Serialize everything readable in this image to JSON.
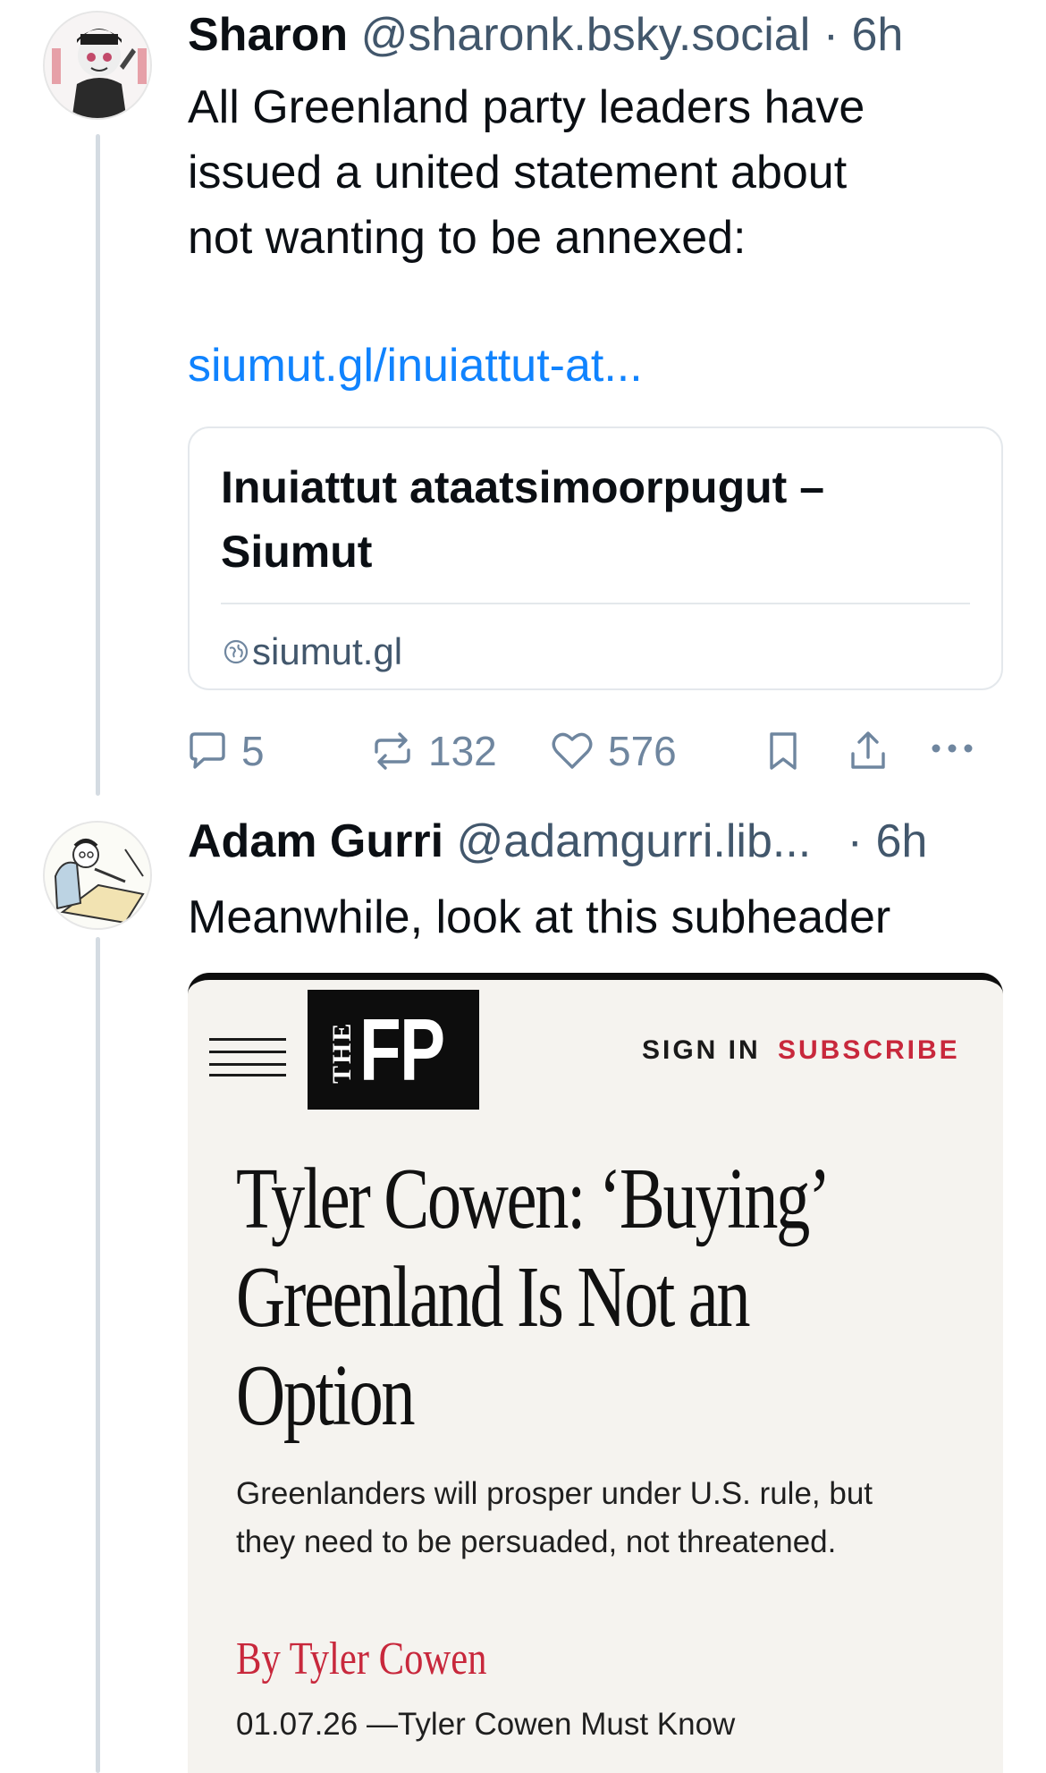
{
  "posts": [
    {
      "author": "Sharon",
      "handle": "@sharonk.bsky.social",
      "separator": "·",
      "time": "6h",
      "text_lines": [
        "All Greenland party leaders have",
        "issued a united statement about",
        "not wanting to be annexed:"
      ],
      "link_text": "siumut.gl/inuiattut-at...",
      "link_card": {
        "title": "Inuiattut ataatsimoorpugut – Siumut",
        "domain": "siumut.gl"
      },
      "actions": {
        "replies": "5",
        "reposts": "132",
        "likes": "576"
      }
    },
    {
      "author": "Adam Gurri",
      "handle": "@adamgurri.lib...",
      "separator": "·",
      "time": "6h",
      "text": "Meanwhile, look at this subheader",
      "embedded_screenshot": {
        "logo_small": "THE",
        "logo_big": "FP",
        "sign_in": "SIGN IN",
        "subscribe": "SUBSCRIBE",
        "headline_lines": [
          "Tyler Cowen: ‘Buying’",
          "Greenland Is Not an",
          "Option"
        ],
        "subheader_lines": [
          "Greenlanders will prosper under U.S. rule, but",
          "they need to be persuaded, not threatened."
        ],
        "byline": "By Tyler Cowen",
        "dateline": "01.07.26 —Tyler Cowen Must Know"
      }
    }
  ],
  "icons": {
    "reply": "reply-bubble-icon",
    "repost": "repost-arrows-icon",
    "like": "heart-icon",
    "bookmark": "bookmark-icon",
    "share": "share-icon",
    "more": "more-dots-icon",
    "globe": "globe-icon",
    "menu": "hamburger-menu-icon"
  },
  "colors": {
    "link": "#1083fe",
    "muted": "#42576c",
    "action": "#6f869f",
    "fp_red": "#c8283c"
  }
}
